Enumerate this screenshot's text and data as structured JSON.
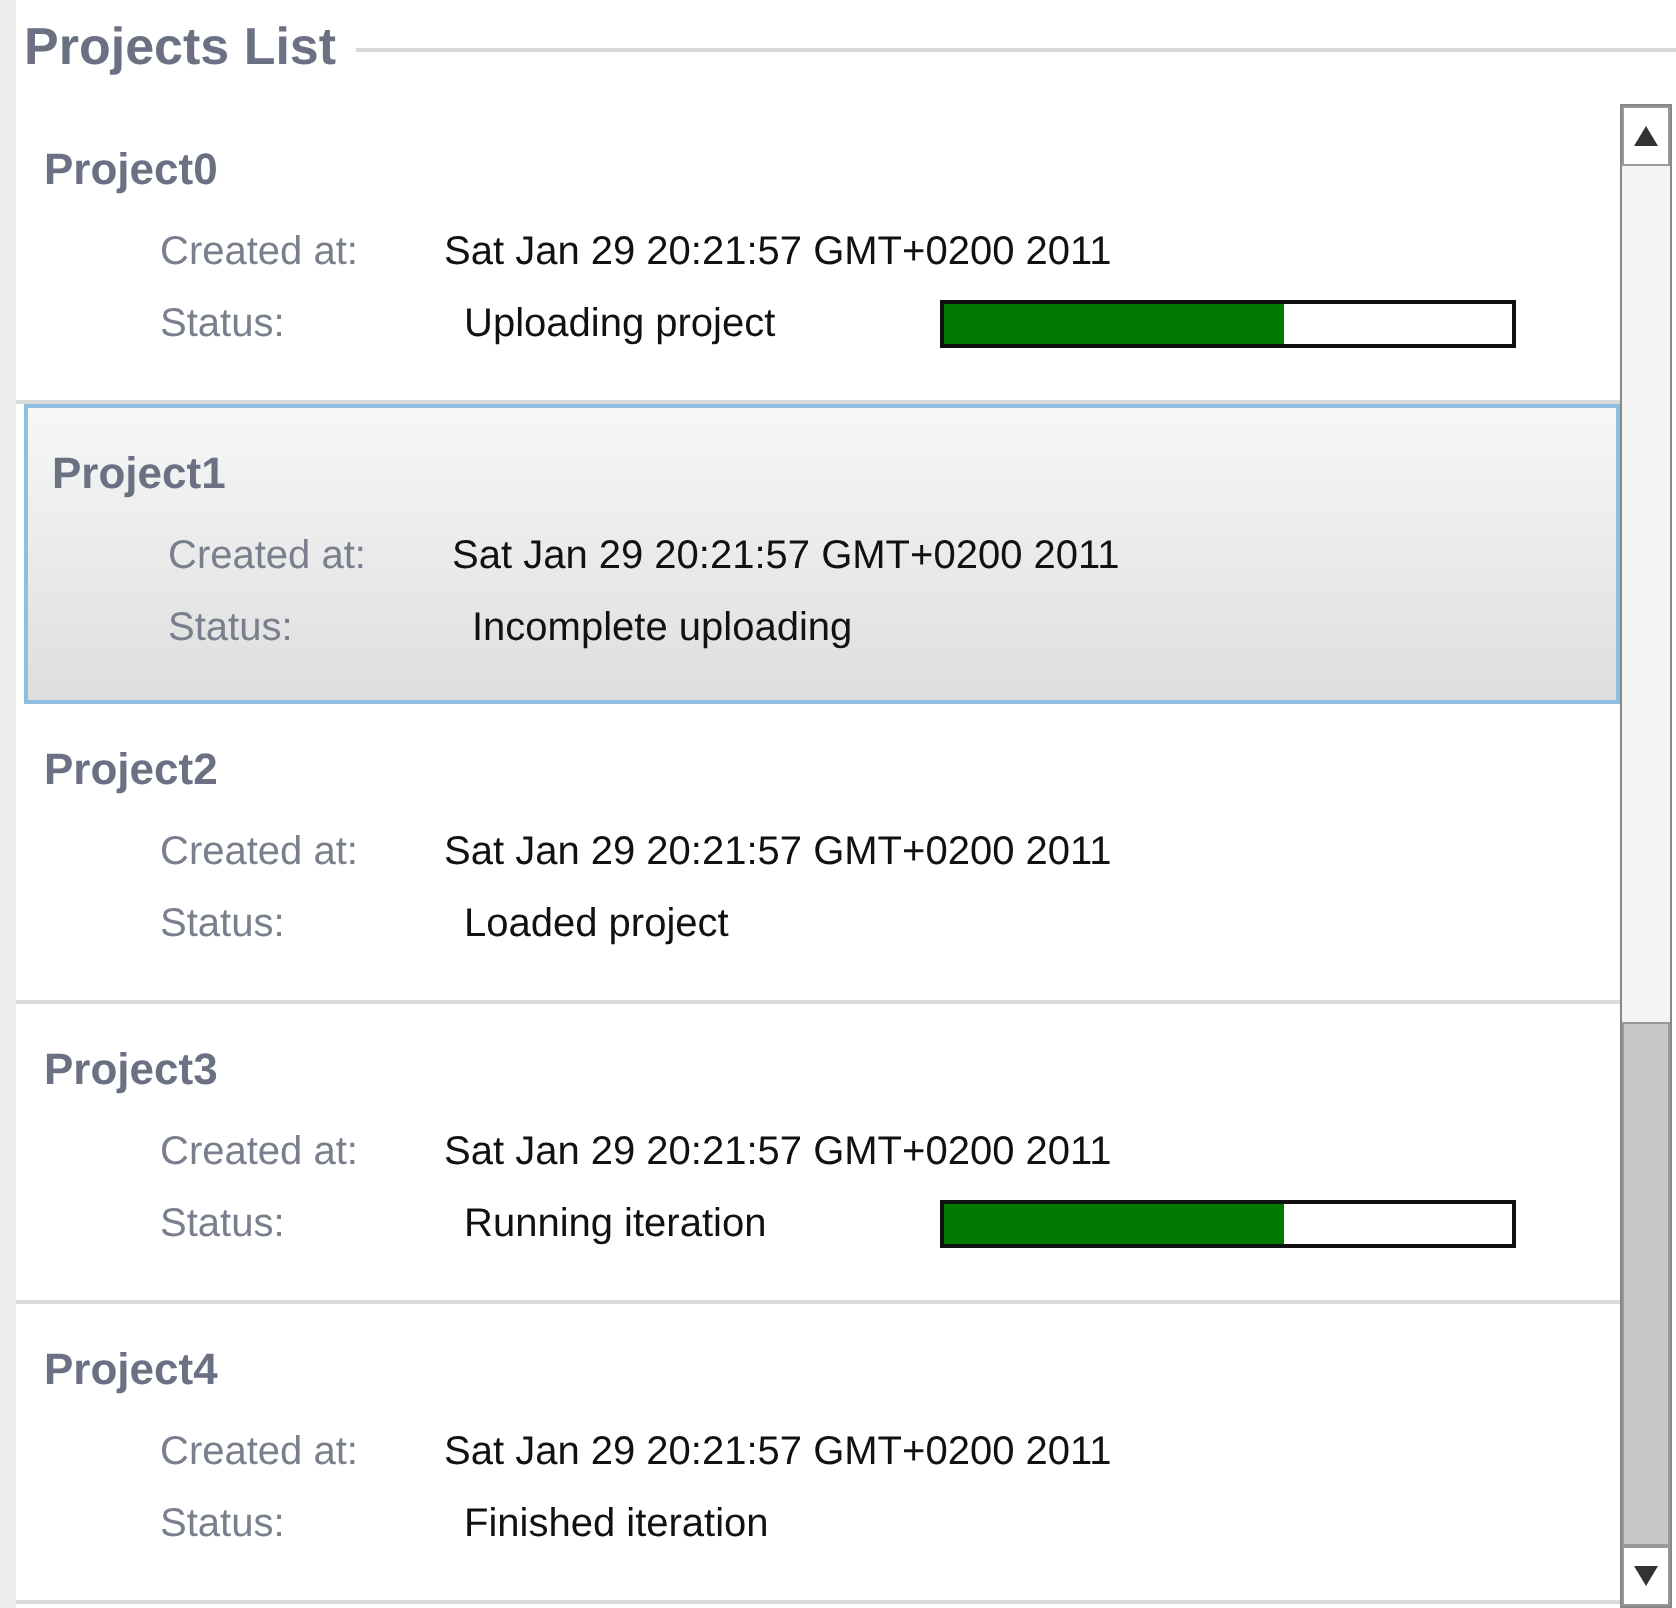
{
  "panel": {
    "title": "Projects List"
  },
  "projects": [
    {
      "name": "Project0",
      "created_label": "Created at:",
      "created": "Sat Jan 29 20:21:57 GMT+0200 2011",
      "status_label": "Status:",
      "status": "Uploading project",
      "selected": false,
      "progress": {
        "level": 0.6
      }
    },
    {
      "name": "Project1",
      "created_label": "Created at:",
      "created": "Sat Jan 29 20:21:57 GMT+0200 2011",
      "status_label": "Status:",
      "status": "Incomplete uploading",
      "selected": true
    },
    {
      "name": "Project2",
      "created_label": "Created at:",
      "created": "Sat Jan 29 20:21:57 GMT+0200 2011",
      "status_label": "Status:",
      "status": "Loaded project",
      "selected": false
    },
    {
      "name": "Project3",
      "created_label": "Created at:",
      "created": "Sat Jan 29 20:21:57 GMT+0200 2011",
      "status_label": "Status:",
      "status": "Running iteration",
      "selected": false,
      "progress": {
        "level": 0.6
      }
    },
    {
      "name": "Project4",
      "created_label": "Created at:",
      "created": "Sat Jan 29 20:21:57 GMT+0200 2011",
      "status_label": "Status:",
      "status": "Finished iteration",
      "selected": false
    }
  ]
}
